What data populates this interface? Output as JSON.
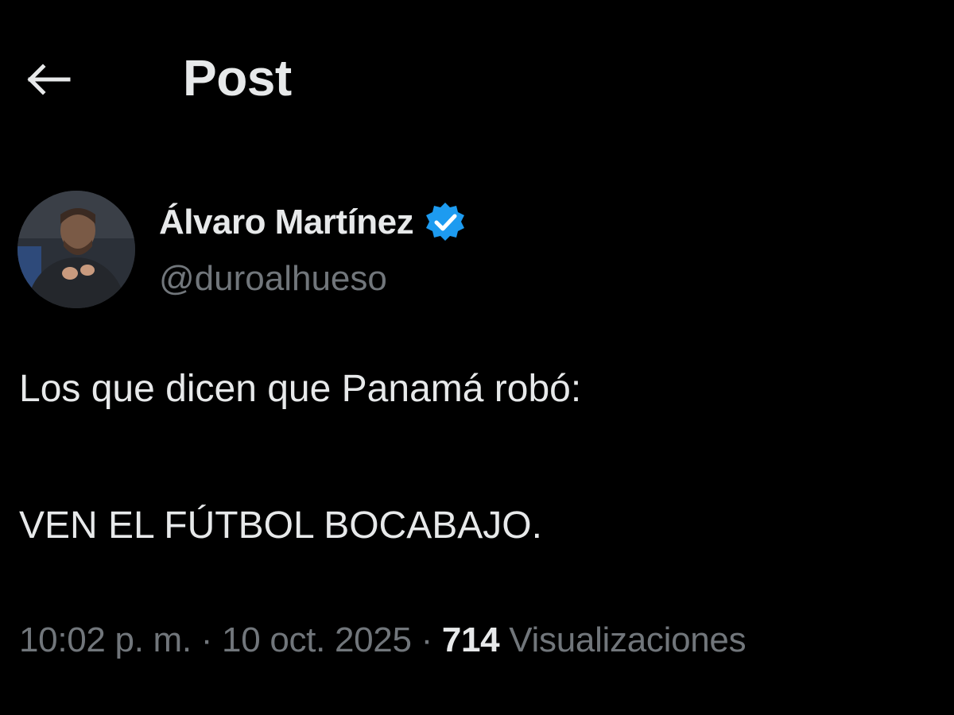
{
  "header": {
    "back_icon": "arrow-left-icon",
    "title": "Post"
  },
  "author": {
    "display_name": "Álvaro Martínez",
    "handle": "@duroalhueso",
    "verified_icon": "verified-badge-icon",
    "verified_color": "#1d9bf0"
  },
  "tweet": {
    "line1": "Los que dicen que Panamá robó:",
    "line2": "VEN EL FÚTBOL BOCABAJO."
  },
  "meta": {
    "time": "10:02 p. m.",
    "separator": " · ",
    "date": "10 oct. 2025",
    "views_count": "714",
    "views_label": "Visualizaciones"
  },
  "colors": {
    "background": "#000000",
    "primary_text": "#e7e9ea",
    "secondary_text": "#71767b",
    "accent": "#1d9bf0"
  }
}
